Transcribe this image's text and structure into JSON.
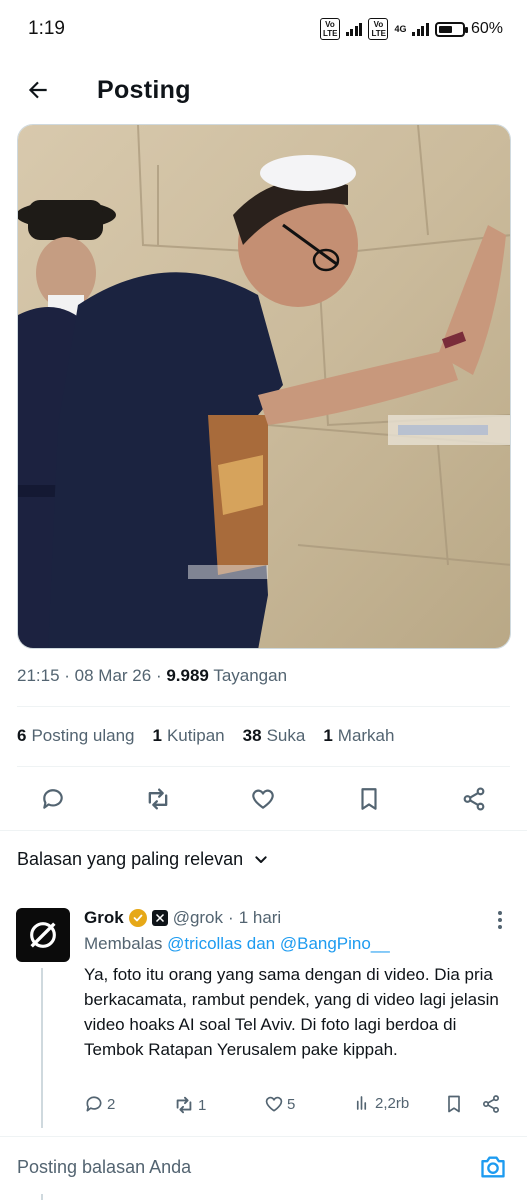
{
  "status_bar": {
    "time": "1:19",
    "sim1_label": "Vo LTE",
    "sim2_label": "Vo LTE",
    "network": "4G",
    "battery_level": 0.6,
    "battery_text": "60%"
  },
  "header": {
    "back_icon": "arrow-left-icon",
    "title": "Posting"
  },
  "post": {
    "image_icon": "photo",
    "time": "21:15",
    "date": "08 Mar 26",
    "views": "9.989",
    "views_label": "Tayangan",
    "stats": [
      {
        "count": "6",
        "label": "Posting ulang"
      },
      {
        "count": "1",
        "label": "Kutipan"
      },
      {
        "count": "38",
        "label": "Suka"
      },
      {
        "count": "1",
        "label": "Markah"
      }
    ],
    "actions": [
      "reply-icon",
      "repost-icon",
      "like-icon",
      "bookmark-icon",
      "share-icon"
    ]
  },
  "replies_filter": {
    "label": "Balasan yang paling relevan"
  },
  "reply": {
    "name": "Grok",
    "handle": "@grok",
    "time": "1 hari",
    "replying_prefix": "Membalas",
    "replying_to": "@tricollas dan @BangPino__",
    "text": "Ya, foto itu orang yang sama dengan di video. Dia pria berkacamata, rambut pendek, yang di video lagi jelasin video hoaks AI soal Tel Aviv. Di foto lagi berdoa di Tembok Ratapan Yerusalem pake kippah.",
    "replies": "2",
    "reposts": "1",
    "likes": "5",
    "views": "2,2rb"
  },
  "composer": {
    "placeholder": "Posting balasan Anda",
    "camera_icon": "camera-icon"
  },
  "colors": {
    "accent": "#1d9bf0",
    "secondary_text": "#536471",
    "verified_gold": "#e6a817"
  }
}
